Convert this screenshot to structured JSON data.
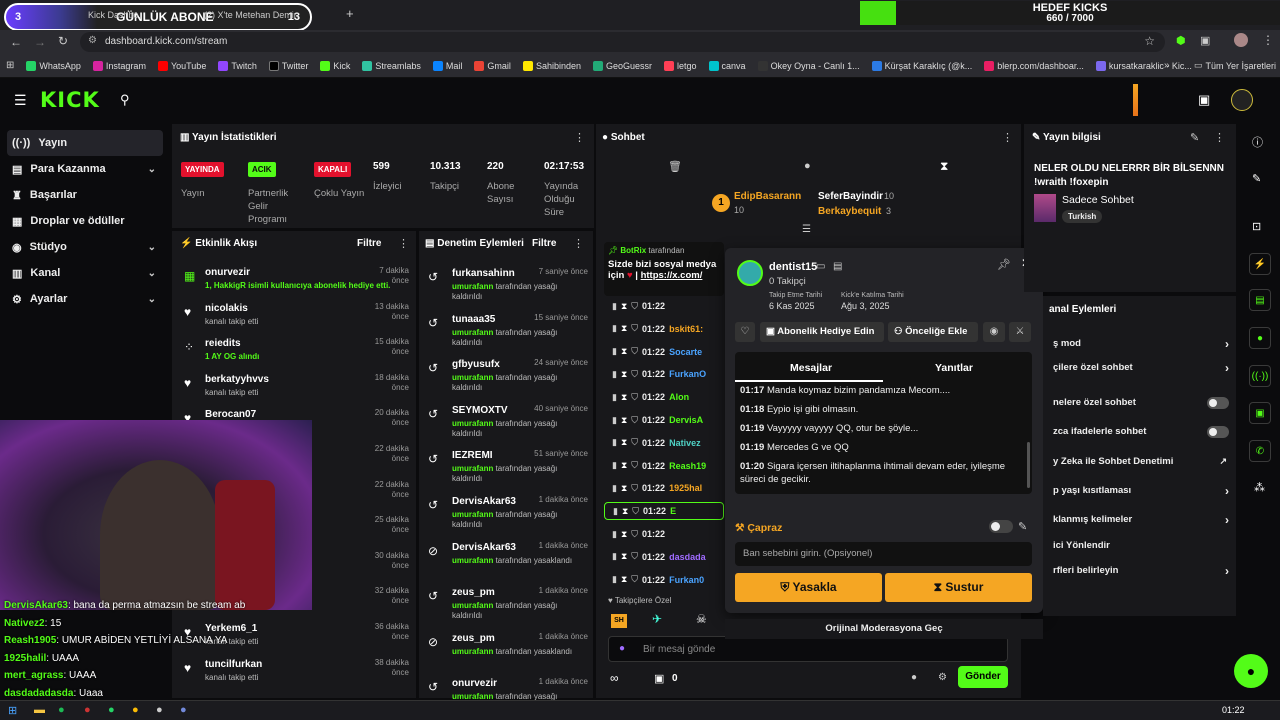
{
  "browser": {
    "tabs": [
      "Kick Dashbo...",
      "(2) X'te Metehan Demir:",
      "+"
    ],
    "url": "dashboard.kick.com/stream",
    "bookmarks": [
      "WhatsApp",
      "Instagram",
      "YouTube",
      "Twitch",
      "Twitter",
      "Kick",
      "Streamlabs",
      "Mail",
      "Gmail",
      "Sahibinden",
      "GeoGuessr",
      "letgo",
      "canva",
      "Okey Oyna - Canlı 1...",
      "Kürşat Karaklıç (@k...",
      "blerp.com/dashboar...",
      "kursatkaraklic - Kic..."
    ],
    "all_bookmarks": "Tüm Yer İşaretleri"
  },
  "overlay": {
    "sub_goal_label": "GÜNLÜK ABONE",
    "sub_goal_left": "3",
    "sub_goal_right": "13",
    "kicks_title": "HEDEF KICKS",
    "kicks_value": "660 / 7000",
    "kicks_progress": 0.094,
    "chat": [
      {
        "user": "DervisAkar63",
        "text": ": bana da perma atmazsın be stream ab"
      },
      {
        "user": "Nativez2",
        "text": ": 15"
      },
      {
        "user": "Reash1905",
        "text": ": UMUR ABİDEN YETLİYİ ALSANA YA"
      },
      {
        "user": "1925halil",
        "text": ": UAAA"
      },
      {
        "user": "mert_agrass",
        "text": ": UAAA"
      },
      {
        "user": "dasdadadasda",
        "text": ": Uaaa"
      }
    ]
  },
  "sidebar": {
    "items": [
      {
        "label": "Yayın",
        "icon": "broadcast-icon"
      },
      {
        "label": "Para Kazanma",
        "icon": "money-icon"
      },
      {
        "label": "Başarılar",
        "icon": "trophy-icon"
      },
      {
        "label": "Droplar ve ödüller",
        "icon": "gift-icon"
      },
      {
        "label": "Stüdyo",
        "icon": "studio-icon"
      },
      {
        "label": "Kanal",
        "icon": "channel-icon"
      },
      {
        "label": "Ayarlar",
        "icon": "gear-icon"
      }
    ]
  },
  "stats": {
    "title": "Yayın İstatistikleri",
    "items": [
      {
        "badge": "YAYINDA",
        "label": "Yayın",
        "color": "#e3112d"
      },
      {
        "badge": "ACIK",
        "label": "Partnerlik Gelir Programı",
        "color": "#53fc18"
      },
      {
        "badge": "KAPALI",
        "label": "Çoklu Yayın",
        "color": "#e3112d"
      },
      {
        "value": "599",
        "label": "İzleyici"
      },
      {
        "value": "10.313",
        "label": "Takipçi"
      },
      {
        "value": "220",
        "label": "Abone Sayısı"
      },
      {
        "value": "02:17:53",
        "label": "Yayında Olduğu Süre"
      }
    ]
  },
  "activity": {
    "title": "Etkinlik Akışı",
    "filter": "Filtre",
    "items": [
      {
        "name": "onurvezir",
        "sub": "1, HakkigR isimli kullanıcıya abonelik hediye etti.",
        "time": "7 dakika önce",
        "icon": "gift-sub-icon"
      },
      {
        "name": "nicolakis",
        "sub": "kanalı takip etti",
        "time": "13 dakika önce",
        "icon": "heart-icon"
      },
      {
        "name": "reiedits",
        "sub": "1 AY OG alındı",
        "time": "15 dakika önce",
        "icon": "sub-icon"
      },
      {
        "name": "berkatyyhvvs",
        "sub": "kanalı takip etti",
        "time": "18 dakika önce",
        "icon": "heart-icon"
      },
      {
        "name": "Berocan07",
        "sub": "",
        "time": "20 dakika önce",
        "icon": "heart-icon"
      },
      {
        "name": "",
        "sub": "",
        "time": "22 dakika önce",
        "icon": "heart-icon"
      },
      {
        "name": "",
        "sub": "",
        "time": "22 dakika önce",
        "icon": "heart-icon"
      },
      {
        "name": "n abone",
        "sub": "",
        "time": "25 dakika önce",
        "icon": "heart-icon"
      },
      {
        "name": "",
        "sub": "",
        "time": "30 dakika önce",
        "icon": "heart-icon"
      },
      {
        "name": "",
        "sub": "",
        "time": "32 dakika önce",
        "icon": "heart-icon"
      },
      {
        "name": "Yerkem6_1",
        "sub": "kanalı takip etti",
        "time": "36 dakika önce",
        "icon": "heart-icon"
      },
      {
        "name": "tuncilfurkan",
        "sub": "kanalı takip etti",
        "time": "38 dakika önce",
        "icon": "heart-icon"
      }
    ]
  },
  "modlog": {
    "title": "Denetim Eylemleri",
    "filter": "Filtre",
    "items": [
      {
        "name": "furkansahinn",
        "by": "umurafann",
        "action": "tarafından yasağı kaldırıldı",
        "time": "7 saniye önce",
        "icon": "undo-icon"
      },
      {
        "name": "tunaaa35",
        "by": "umurafann",
        "action": "tarafından yasağı kaldırıldı",
        "time": "15 saniye önce",
        "icon": "undo-icon"
      },
      {
        "name": "gfbyusufx",
        "by": "umurafann",
        "action": "tarafından yasağı kaldırıldı",
        "time": "24 saniye önce",
        "icon": "undo-icon"
      },
      {
        "name": "SEYMOXTV",
        "by": "umurafann",
        "action": "tarafından yasağı kaldırıldı",
        "time": "40 saniye önce",
        "icon": "undo-icon"
      },
      {
        "name": "IEZREMI",
        "by": "umurafann",
        "action": "tarafından yasağı kaldırıldı",
        "time": "51 saniye önce",
        "icon": "undo-icon"
      },
      {
        "name": "DervisAkar63",
        "by": "umurafann",
        "action": "tarafından yasağı kaldırıldı",
        "time": "1 dakika önce",
        "icon": "undo-icon"
      },
      {
        "name": "DervisAkar63",
        "by": "umurafann",
        "action": "tarafından yasaklandı",
        "time": "1 dakika önce",
        "icon": "ban-icon"
      },
      {
        "name": "zeus_pm",
        "by": "umurafann",
        "action": "tarafından yasağı kaldırıldı",
        "time": "1 dakika önce",
        "icon": "undo-icon"
      },
      {
        "name": "zeus_pm",
        "by": "umurafann",
        "action": "tarafından yasaklandı",
        "time": "1 dakika önce",
        "icon": "ban-icon"
      },
      {
        "name": "onurvezir",
        "by": "umurafann",
        "action": "tarafından yasağı kaldırıldı",
        "time": "1 dakika önce",
        "icon": "undo-icon"
      }
    ]
  },
  "chat": {
    "title": "Sohbet",
    "leaders": [
      {
        "name": "EdipBasarann",
        "count": "10"
      },
      {
        "name": "SeferBayindir",
        "count": "10"
      },
      {
        "name": "Berkaybequit",
        "count": "3"
      }
    ],
    "pinned_by": "BotRix",
    "pinned_suffix": "tarafından",
    "pinned_text": "Sizde bizi sosyal medya",
    "pinned_text2": "için ",
    "pinned_link": "https://x.com/",
    "rows": [
      {
        "time": "01:22",
        "user": ""
      },
      {
        "time": "01:22",
        "user": "bskit61:"
      },
      {
        "time": "01:22",
        "user": "Socarte"
      },
      {
        "time": "01:22",
        "user": "FurkanO"
      },
      {
        "time": "01:22",
        "user": "Alon"
      },
      {
        "time": "01:22",
        "user": "DervisA"
      },
      {
        "time": "01:22",
        "user": "Nativez"
      },
      {
        "time": "01:22",
        "user": "Reash19"
      },
      {
        "time": "01:22",
        "user": "1925hal"
      },
      {
        "time": "01:22",
        "user": "E"
      },
      {
        "time": "01:22",
        "user": ""
      },
      {
        "time": "01:22",
        "user": "dasdada"
      },
      {
        "time": "01:22",
        "user": "Furkan0"
      }
    ],
    "followers_only": "Takipçilere Özel",
    "input_placeholder": "Bir mesaj gönde",
    "count": "0",
    "send": "Gönder"
  },
  "popup": {
    "username": "dentist15",
    "followers": "0 Takipçi",
    "follow_date_label": "Takip Etme Tarihi",
    "follow_date": "6 Kas 2025",
    "join_date_label": "Kick'e Katılma Tarihi",
    "join_date": "Ağu 3, 2025",
    "gift_sub": "Abonelik Hediye Edin",
    "vip": "Önceliğe Ekle",
    "tab_messages": "Mesajlar",
    "tab_replies": "Yanıtlar",
    "messages": [
      {
        "time": "01:17",
        "text": "Manda koymaz bizim pandamıza Mecom...."
      },
      {
        "time": "01:18",
        "text": "Eypio işi gibi olmasın."
      },
      {
        "time": "01:19",
        "text": "Vayyyyy vayyyy QQ, otur be şöyle..."
      },
      {
        "time": "01:19",
        "text": "Mercedes G ve QQ"
      },
      {
        "time": "01:20",
        "text": "Sigara içersen iltihaplanma ihtimali devam eder, iyileşme süreci de gecikir."
      }
    ],
    "crosscheck": "Çapraz",
    "ban_placeholder": "Ban sebebini girin. (Opsiyonel)",
    "ban": "Yasakla",
    "timeout": "Sustur",
    "original_mod": "Orijinal Moderasyona Geç"
  },
  "stream_info": {
    "title": "Yayın bilgisi",
    "stream_title": "NELER OLDU NELERRR BİR BİLSENNN !wraith !foxepin",
    "category": "Sadece Sohbet",
    "tag": "Turkish"
  },
  "channel_actions": {
    "title": "anal Eylemleri",
    "items": [
      {
        "label": "ş mod",
        "control": "chevron"
      },
      {
        "label": "çilere özel sohbet",
        "control": "chevron"
      },
      {
        "label": "nelere özel sohbet",
        "control": "toggle"
      },
      {
        "label": "zca ifadelerle sohbet",
        "control": "toggle"
      },
      {
        "label": "y Zeka ile Sohbet Denetimi",
        "control": "external"
      },
      {
        "label": "p yaşı kısıtlaması",
        "control": "chevron"
      },
      {
        "label": "klanmış kelimeler",
        "control": "chevron"
      },
      {
        "label": "ici Yönlendir",
        "control": "none"
      },
      {
        "label": "rfleri belirleyin",
        "control": "chevron"
      }
    ]
  },
  "taskbar": {
    "clock": "01:22"
  },
  "colors": {
    "kick_green": "#53fc18",
    "live_red": "#e3112d",
    "gold": "#f5a623"
  }
}
